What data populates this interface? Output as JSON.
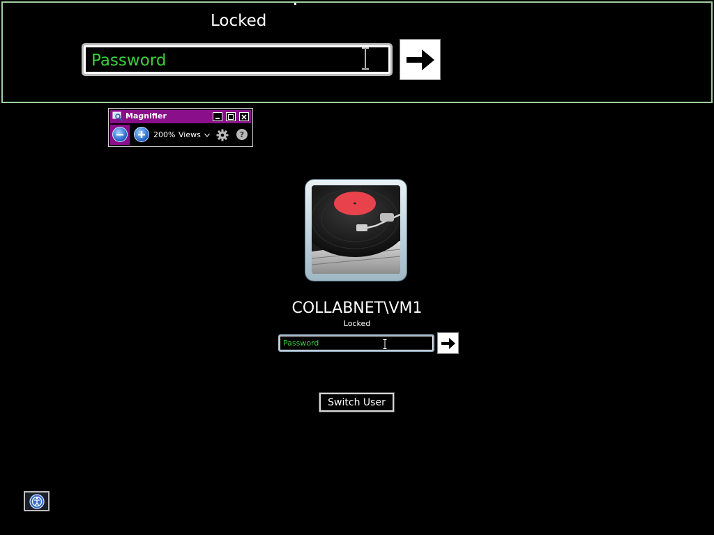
{
  "magnified_view": {
    "status_text": "Locked",
    "password_placeholder": "Password"
  },
  "magnifier": {
    "title": "Magnifier",
    "zoom_level": "200%",
    "views_label": "Views",
    "help_glyph": "?",
    "icons": [
      "magnifier-app-icon",
      "minimize-icon",
      "maximize-icon",
      "close-icon",
      "zoom-out-icon",
      "zoom-in-icon",
      "chevron-down-icon",
      "gear-icon",
      "help-icon"
    ]
  },
  "login": {
    "username": "COLLABNET\\VM1",
    "status": "Locked",
    "password_placeholder": "Password",
    "submit_icon": "arrow-right-icon",
    "switch_user_label": "Switch User"
  },
  "accessibility": {
    "icon": "ease-of-access-icon"
  },
  "colors": {
    "magnifier_title_bg": "#8a0f8a",
    "placeholder_green": "#3ad13a",
    "lens_border": "#9fcf9f"
  }
}
